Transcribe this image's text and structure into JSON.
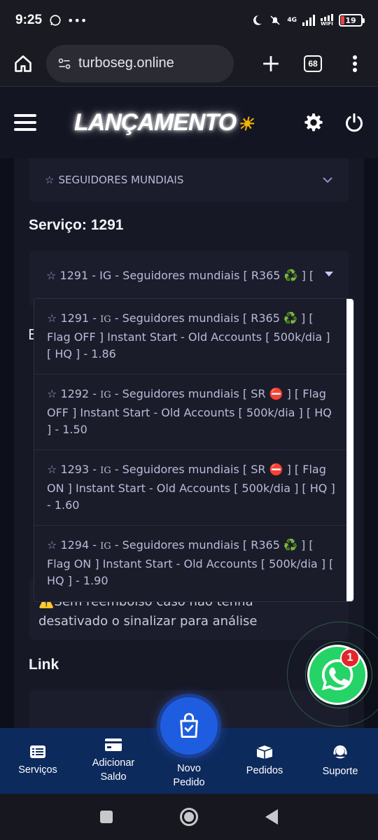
{
  "status_bar": {
    "time": "9:25",
    "battery": "19",
    "network": "4G",
    "wifi_label": "WIFI"
  },
  "browser": {
    "url": "turboseg.online",
    "tab_count": "68"
  },
  "header": {
    "logo": "LANÇAMENTO",
    "logo_sun": "☀"
  },
  "form": {
    "category_value": "SEGUIDORES MUNDIAIS",
    "service_label": "Serviço: 1291",
    "service_selected": "1291 - IG - Seguidores mundiais [ R365 ♻️ ] [",
    "bg_letter": "E",
    "description": "⚠️Sem reembolso caso não tenha desativado o sinalizar para análise",
    "link_label": "Link"
  },
  "dropdown": {
    "options": [
      {
        "pre": "1291 - ",
        "ig": "IG",
        "post": " - Seguidores mundiais [ R365 ♻️ ] [ Flag OFF ] Instant Start - Old Accounts [ 500k/dia ] [ HQ ] - 1.86"
      },
      {
        "pre": "1292 - ",
        "ig": "IG",
        "post": " - Seguidores mundiais [ SR ⛔ ] [ Flag OFF ] Instant Start - Old Accounts [ 500k/dia ] [ HQ ] - 1.50"
      },
      {
        "pre": "1293 - ",
        "ig": "IG",
        "post": " - Seguidores mundiais [ SR ⛔ ] [ Flag ON ] Instant Start - Old Accounts [ 500k/dia ] [ HQ ] - 1.60"
      },
      {
        "pre": "1294 - ",
        "ig": "IG",
        "post": " - Seguidores mundiais [ R365 ♻️ ] [ Flag ON ] Instant Start - Old Accounts [ 500k/dia ] [ HQ ] - 1.90"
      }
    ]
  },
  "whatsapp": {
    "badge": "1"
  },
  "bottom_nav": {
    "servicos": "Serviços",
    "adicionar_saldo_1": "Adicionar",
    "adicionar_saldo_2": "Saldo",
    "novo_pedido_1": "Novo",
    "novo_pedido_2": "Pedido",
    "pedidos": "Pedidos",
    "suporte": "Suporte"
  },
  "colors": {
    "accent": "#1f5de0",
    "nav_bg": "#0d2a5c",
    "whatsapp": "#25d366",
    "badge": "#e3262b"
  }
}
